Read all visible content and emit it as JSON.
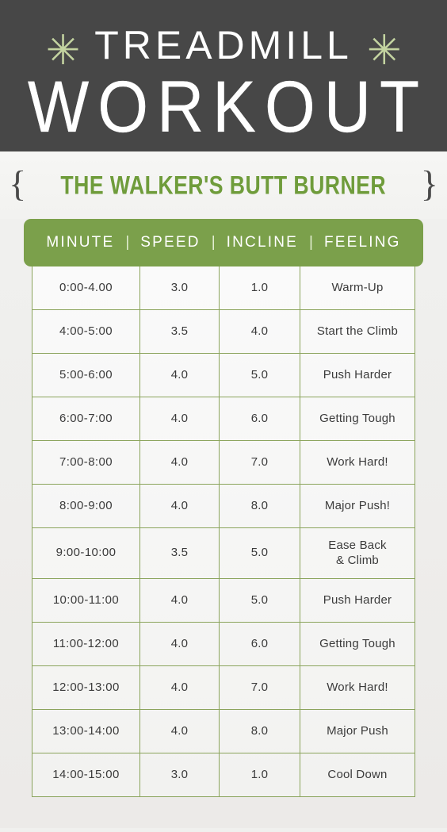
{
  "hero": {
    "asterisk_left": "✳",
    "asterisk_right": "✳",
    "title_main": "TREADMILL",
    "title_sub": "WORKOUT"
  },
  "subtitle": {
    "brace_open": "{",
    "text": "THE WALKER'S BUTT BURNER",
    "brace_close": "}"
  },
  "table": {
    "headers": [
      "MINUTE",
      "SPEED",
      "INCLINE",
      "FEELING"
    ],
    "separator": "|",
    "rows": [
      {
        "minute": "0:00-4.00",
        "speed": "3.0",
        "incline": "1.0",
        "feeling": "Warm-Up"
      },
      {
        "minute": "4:00-5:00",
        "speed": "3.5",
        "incline": "4.0",
        "feeling": "Start the Climb"
      },
      {
        "minute": "5:00-6:00",
        "speed": "4.0",
        "incline": "5.0",
        "feeling": "Push Harder"
      },
      {
        "minute": "6:00-7:00",
        "speed": "4.0",
        "incline": "6.0",
        "feeling": "Getting Tough"
      },
      {
        "minute": "7:00-8:00",
        "speed": "4.0",
        "incline": "7.0",
        "feeling": "Work Hard!"
      },
      {
        "minute": "8:00-9:00",
        "speed": "4.0",
        "incline": "8.0",
        "feeling": "Major Push!"
      },
      {
        "minute": "9:00-10:00",
        "speed": "3.5",
        "incline": "5.0",
        "feeling": "Ease Back\n& Climb"
      },
      {
        "minute": "10:00-11:00",
        "speed": "4.0",
        "incline": "5.0",
        "feeling": "Push Harder"
      },
      {
        "minute": "11:00-12:00",
        "speed": "4.0",
        "incline": "6.0",
        "feeling": "Getting Tough"
      },
      {
        "minute": "12:00-13:00",
        "speed": "4.0",
        "incline": "7.0",
        "feeling": "Work Hard!"
      },
      {
        "minute": "13:00-14:00",
        "speed": "4.0",
        "incline": "8.0",
        "feeling": "Major Push"
      },
      {
        "minute": "14:00-15:00",
        "speed": "3.0",
        "incline": "1.0",
        "feeling": "Cool Down"
      }
    ]
  },
  "colors": {
    "hero_background": "#474747",
    "accent_green": "#7ba04b",
    "subtitle_green": "#6f9c3b",
    "asterisk_green": "#c3d3a0",
    "border_green": "#8ba45c",
    "page_background": "#f1f1ef",
    "text_dark": "#3b3b3b"
  }
}
